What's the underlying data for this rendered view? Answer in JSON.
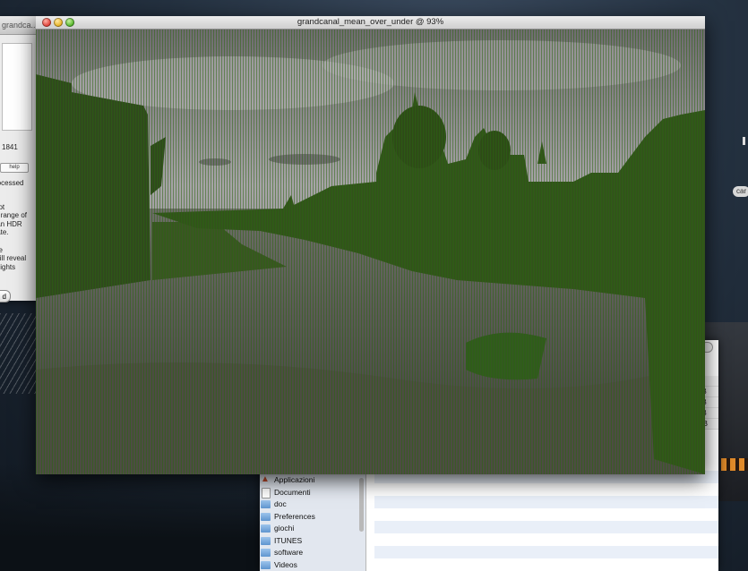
{
  "main_window": {
    "title": "grandcanal_mean_over_under @ 93%",
    "image_name": "grandcanal-photo"
  },
  "left_window": {
    "title": "grandca...",
    "number": "1841",
    "help_label": "help",
    "para1": "rocessed",
    "para2": "not\ne range of\n an HDR\ntate.",
    "para3": "ge\nwill reveal\nnlights",
    "button_label": "d"
  },
  "right_tag": "car",
  "finder": {
    "size_column": [
      "ni",
      "KB",
      "KB",
      "KB",
      "MB"
    ],
    "sidebar_items": [
      {
        "label": "Applicazioni",
        "icon": "applications-icon"
      },
      {
        "label": "Documenti",
        "icon": "document-icon"
      },
      {
        "label": "doc",
        "icon": "folder-icon"
      },
      {
        "label": "Preferences",
        "icon": "folder-icon"
      },
      {
        "label": "giochi",
        "icon": "folder-icon"
      },
      {
        "label": "ITUNES",
        "icon": "folder-icon"
      },
      {
        "label": "software",
        "icon": "folder-icon"
      },
      {
        "label": "Videos",
        "icon": "folder-icon"
      }
    ]
  },
  "colors": {
    "image_overlay": "#3a6b1a",
    "sky": "#9a9a9a"
  }
}
